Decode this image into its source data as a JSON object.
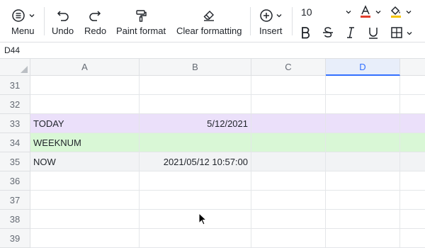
{
  "toolbar": {
    "menu": "Menu",
    "undo": "Undo",
    "redo": "Redo",
    "paint_format": "Paint format",
    "clear_formatting": "Clear formatting",
    "insert": "Insert",
    "font_size": "10",
    "font_color": "#e03e2d",
    "fill_color": "#f5c400"
  },
  "name_box": "D44",
  "columns": [
    "A",
    "B",
    "C",
    "D"
  ],
  "selected_column": "D",
  "rows": [
    {
      "num": "31",
      "a": "",
      "b": ""
    },
    {
      "num": "32",
      "a": "",
      "b": ""
    },
    {
      "num": "33",
      "a": "TODAY",
      "b": "5/12/2021"
    },
    {
      "num": "34",
      "a": "WEEKNUM",
      "b": ""
    },
    {
      "num": "35",
      "a": "NOW",
      "b": "2021/05/12 10:57:00"
    },
    {
      "num": "36",
      "a": "",
      "b": ""
    },
    {
      "num": "37",
      "a": "",
      "b": ""
    },
    {
      "num": "38",
      "a": "",
      "b": ""
    },
    {
      "num": "39",
      "a": "",
      "b": ""
    }
  ],
  "row_fills": {
    "33": "#ebe0fa",
    "34": "#d9f7d6",
    "35": "#f2f3f5"
  }
}
